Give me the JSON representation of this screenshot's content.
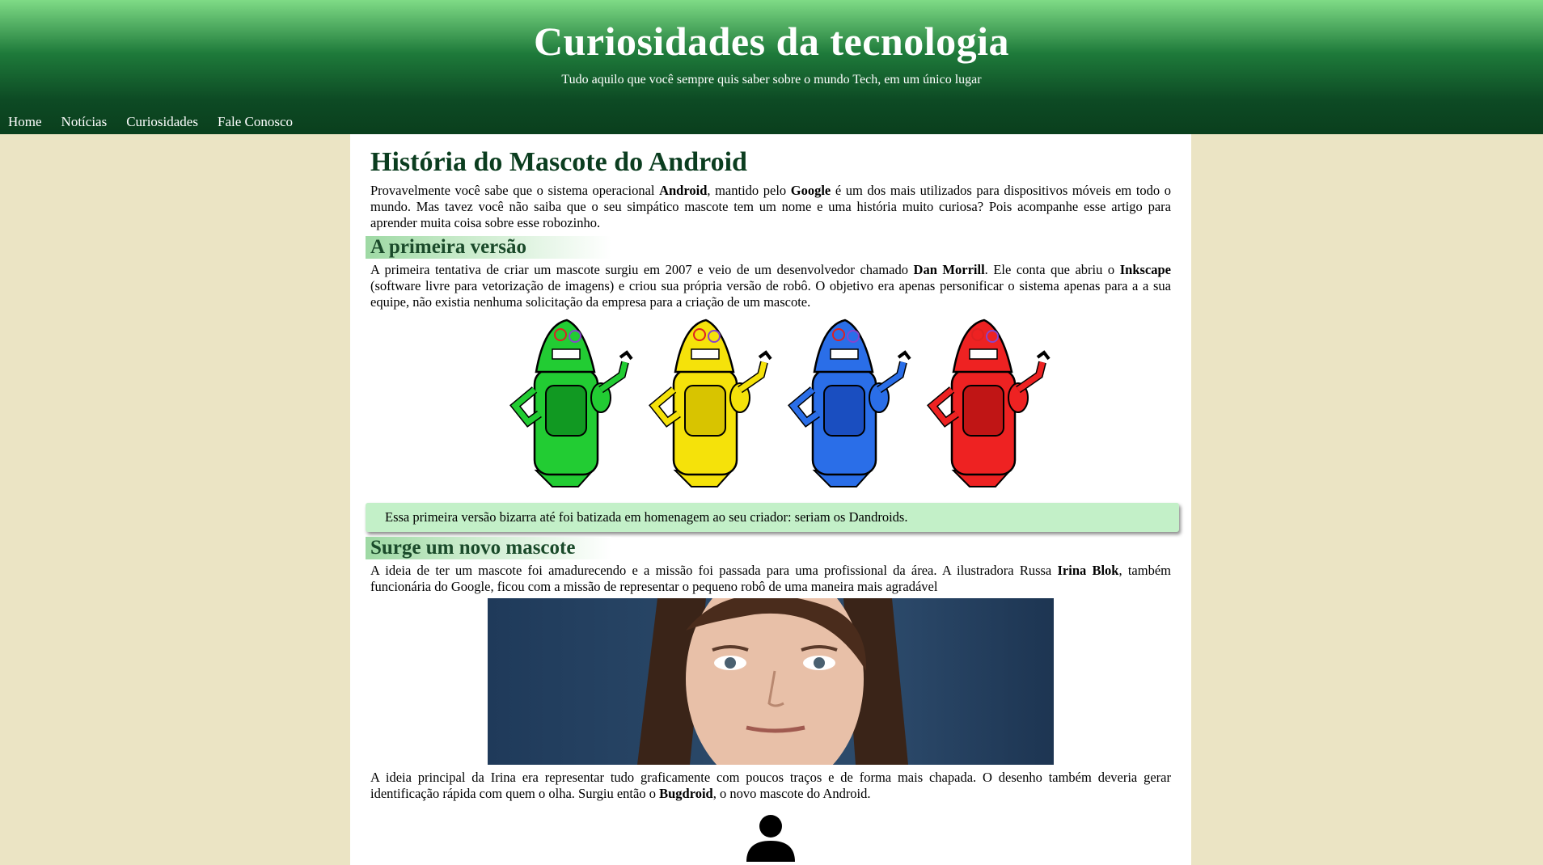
{
  "header": {
    "title": "Curiosidades da tecnologia",
    "subtitle": "Tudo aquilo que você sempre quis saber sobre o mundo Tech, em um único lugar"
  },
  "nav": {
    "items": [
      "Home",
      "Notícias",
      "Curiosidades",
      "Fale Conosco"
    ]
  },
  "article": {
    "title": "História do Mascote do Android",
    "intro": {
      "t1": " Provavelmente você sabe que o sistema operacional ",
      "b1": "Android",
      "t2": ", mantido pelo ",
      "b2": "Google",
      "t3": " é um dos mais utilizados para dispositivos móveis em todo o mundo. Mas tavez você não saiba que o seu simpático mascote tem um nome e uma história muito curiosa? Pois acompanhe esse artigo para aprender muita coisa sobre esse robozinho."
    },
    "section1": {
      "heading": "A primeira versão",
      "t1": " A primeira tentativa de criar um mascote surgiu em 2007 e veio de um desenvolvedor chamado ",
      "b1": "Dan Morrill",
      "t2": ". Ele conta que abriu o ",
      "b2": "Inkscape",
      "t3": " (software livre para vetorização de imagens) e criou sua própria versão de robô. O objetivo era apenas personificar o sistema apenas para a a sua equipe, não existia nenhuma solicitação da empresa para a criação de um mascote.",
      "note": "Essa primeira versão bizarra até foi batizada em homenagem ao seu criador: seriam os Dandroids.",
      "robot_colors": [
        "#22cc33",
        "#f5e20a",
        "#2a6ee8",
        "#ee2222"
      ]
    },
    "section2": {
      "heading": "Surge um novo mascote",
      "t1": " A ideia de ter um mascote foi amadurecendo e a missão foi passada para uma profissional da área. A ilustradora Russa ",
      "b1": "Irina Blok",
      "t2": ", também funcionária do Google, ficou com a missão de representar o pequeno robô de uma maneira mais agradável",
      "p2_t1": " A ideia principal da Irina era representar tudo graficamente com poucos traços e de forma mais chapada. O desenho também deveria gerar identificação rápida com quem o olha. Surgiu então o ",
      "p2_b1": "Bugdroid",
      "p2_t2": ", o novo mascote do Android."
    }
  }
}
